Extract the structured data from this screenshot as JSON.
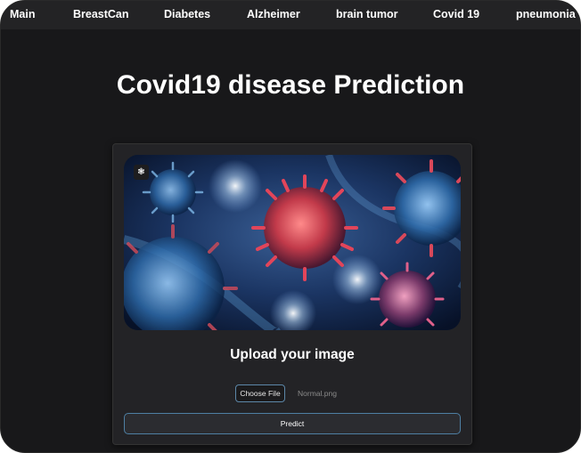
{
  "nav": {
    "items": [
      "Main",
      "BreastCan",
      "Diabetes",
      "Alzheimer",
      "brain tumor",
      "Covid 19",
      "pneumonia"
    ]
  },
  "page": {
    "title": "Covid19 disease Prediction"
  },
  "card": {
    "badge_icon": "brain-icon",
    "upload_title": "Upload your image",
    "choose_file_label": "Choose File",
    "file_name": "Normal.png",
    "predict_label": "Predict"
  },
  "colors": {
    "background": "#18181a",
    "nav_bg": "#232325",
    "card_bg": "#232326",
    "accent_border": "#4e7fa3"
  }
}
